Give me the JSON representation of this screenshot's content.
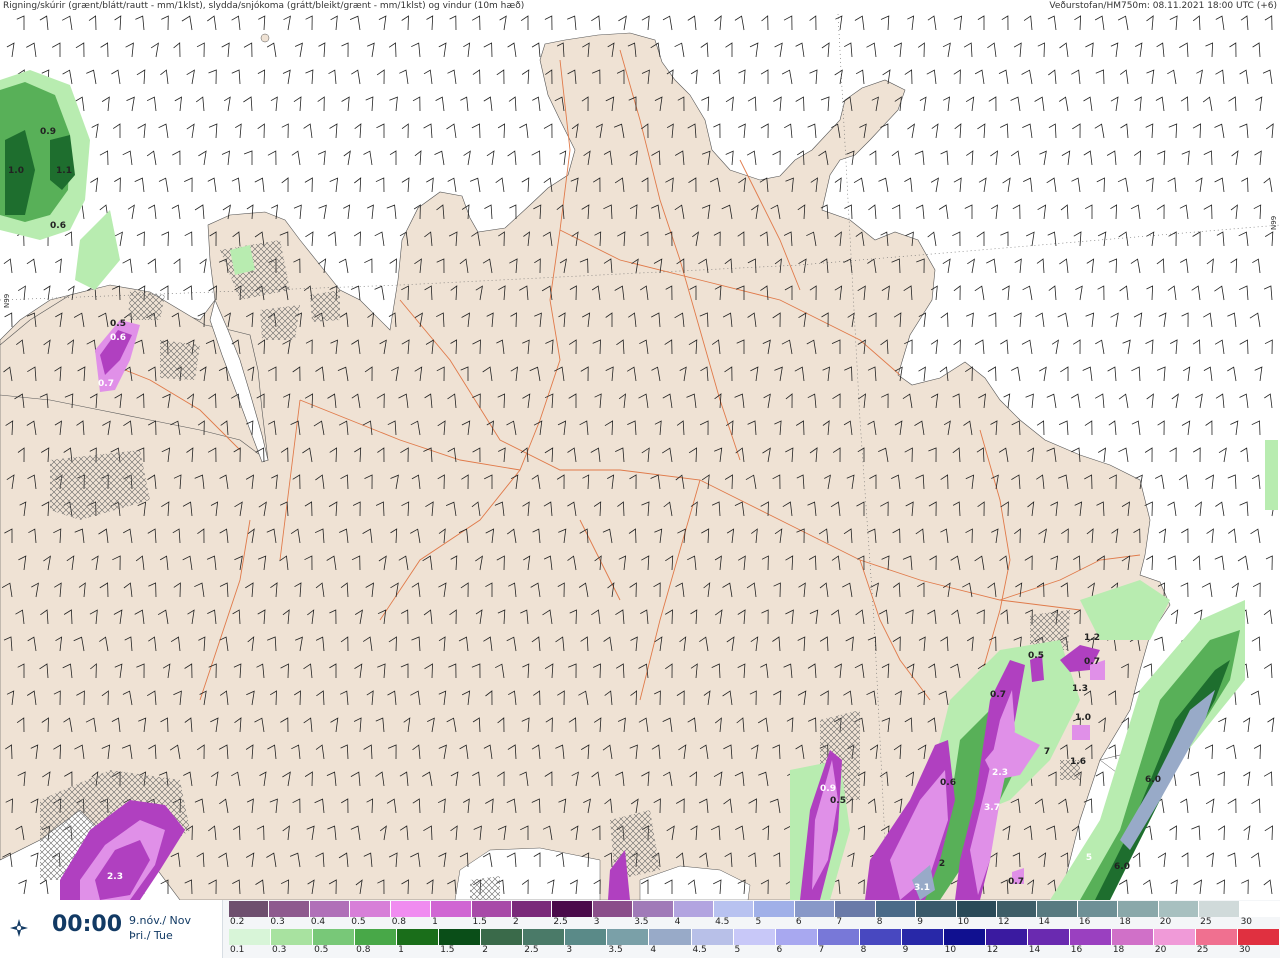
{
  "header": {
    "left": "Rigning/skúrir (grænt/blátt/rautt - mm/1klst), slydda/snjókoma (grátt/bleikt/grænt - mm/1klst) og vindur (10m hæð)",
    "right": "Veðurstofan/HM750m: 08.11.2021 18:00 UTC (+6)"
  },
  "map": {
    "grid_label_left": "N99",
    "grid_label_right": "N99",
    "labels": [
      {
        "text": "0.9",
        "color": "#222222"
      },
      {
        "text": "1.0",
        "color": "#222222"
      },
      {
        "text": "1.1",
        "color": "#222222"
      },
      {
        "text": "0.6",
        "color": "#222222"
      },
      {
        "text": "0.5",
        "color": "#222222"
      },
      {
        "text": "0.6",
        "color": "#ffffff"
      },
      {
        "text": "0.7",
        "color": "#ffffff"
      },
      {
        "text": "2.3",
        "color": "#ffffff"
      },
      {
        "text": "0.9",
        "color": "#ffffff"
      },
      {
        "text": "0.5",
        "color": "#222222"
      },
      {
        "text": "0.6",
        "color": "#222222"
      },
      {
        "text": "2.3",
        "color": "#ffffff"
      },
      {
        "text": "3.7",
        "color": "#ffffff"
      },
      {
        "text": "3.1",
        "color": "#ffffff"
      },
      {
        "text": "2",
        "color": "#222222"
      },
      {
        "text": "0.7",
        "color": "#222222"
      },
      {
        "text": "0.5",
        "color": "#222222"
      },
      {
        "text": "0.7",
        "color": "#222222"
      },
      {
        "text": "1.3",
        "color": "#222222"
      },
      {
        "text": "1.2",
        "color": "#222222"
      },
      {
        "text": "0.7",
        "color": "#222222"
      },
      {
        "text": "1.0",
        "color": "#222222"
      },
      {
        "text": "1.6",
        "color": "#222222"
      },
      {
        "text": "6.0",
        "color": "#222222"
      },
      {
        "text": "6.0",
        "color": "#222222"
      },
      {
        "text": "5",
        "color": "#ffffff"
      },
      {
        "text": "7",
        "color": "#222222"
      }
    ]
  },
  "time": {
    "value": "00:00",
    "date_line1": "9.nóv./ Nov",
    "date_line2": "Þri./ Tue"
  },
  "icons": {
    "play": "crosshair-play-icon"
  },
  "legend": {
    "snow": {
      "labels": [
        "0.2",
        "0.3",
        "0.4",
        "0.5",
        "0.8",
        "1",
        "1.5",
        "2",
        "2.5",
        "3",
        "3.5",
        "4",
        "4.5",
        "5",
        "6",
        "7",
        "8",
        "9",
        "10",
        "12",
        "14",
        "16",
        "18",
        "20",
        "25",
        "30"
      ],
      "colors": [
        "#6e4f6e",
        "#8e5a8e",
        "#b070b8",
        "#d77fd8",
        "#f08cf0",
        "#d066d3",
        "#a84aa8",
        "#7a2a7a",
        "#4a0a4a",
        "#8a4e8a",
        "#a07ab8",
        "#b2a4e0",
        "#b8c2f0",
        "#a0b0e8",
        "#8898c8",
        "#6a7aa8",
        "#4a6a88",
        "#3a5a6a",
        "#2a4a58",
        "#3e5e68",
        "#587a80",
        "#6e9096",
        "#8aa8aa",
        "#a8c0c0",
        "#d0dada",
        "#ffffff"
      ]
    },
    "rain": {
      "labels": [
        "0.1",
        "0.3",
        "0.5",
        "0.8",
        "1",
        "1.5",
        "2",
        "2.5",
        "3",
        "3.5",
        "4",
        "4.5",
        "5",
        "6",
        "7",
        "8",
        "9",
        "10",
        "12",
        "14",
        "16",
        "18",
        "20",
        "25",
        "30"
      ],
      "colors": [
        "#d8f5d8",
        "#a8e2a0",
        "#78c878",
        "#48a848",
        "#1a6e1a",
        "#0a4e18",
        "#3a6a4a",
        "#4a7a68",
        "#5a8a88",
        "#7aa0a8",
        "#98aac8",
        "#b8c0e8",
        "#c8c8f8",
        "#a8a8f0",
        "#7878d8",
        "#4848c0",
        "#2828a8",
        "#101090",
        "#3a1aa0",
        "#6a2ab0",
        "#9a40c0",
        "#d070c8",
        "#f09ad8",
        "#f07090",
        "#e03040"
      ]
    }
  },
  "colors": {
    "land": "#efe2d4",
    "sea": "#ffffff",
    "roads": "#e07a4a",
    "rain_light": "#b8ecb0",
    "rain_mid": "#58b058",
    "rain_dark": "#1e6e2e",
    "snow_light": "#e090e8",
    "snow_mid": "#b040c0",
    "snow_dark": "#6a1a6e"
  }
}
